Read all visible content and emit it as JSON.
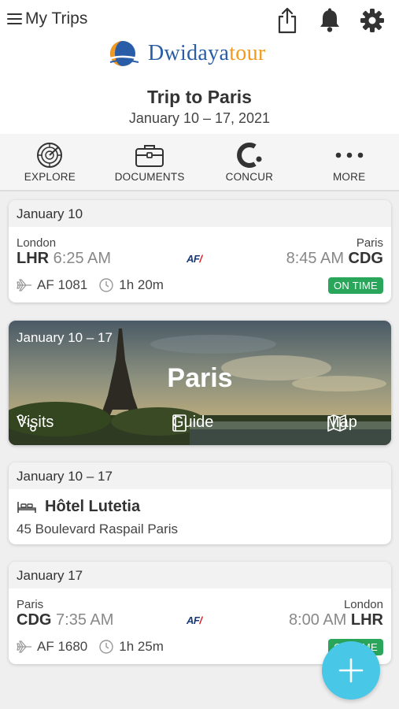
{
  "header": {
    "menu_label": "My Trips",
    "logo_text_main": "Dwidaya",
    "logo_text_accent": "tour",
    "trip_title": "Trip to Paris",
    "trip_dates": "January 10 – 17, 2021",
    "icons": [
      "share-icon",
      "bell-icon",
      "gear-icon"
    ]
  },
  "nav": [
    {
      "label": "EXPLORE",
      "icon": "radar-icon"
    },
    {
      "label": "DOCUMENTS",
      "icon": "briefcase-icon"
    },
    {
      "label": "CONCUR",
      "icon": "concur-icon"
    },
    {
      "label": "MORE",
      "icon": "more-dots-icon"
    }
  ],
  "flight1": {
    "date": "January 10",
    "from_city": "London",
    "from_code": "LHR",
    "dep_time": "6:25 AM",
    "to_city": "Paris",
    "to_code": "CDG",
    "arr_time": "8:45 AM",
    "airline_logo": "AF",
    "flight_no": "AF 1081",
    "duration": "1h 20m",
    "status": "ON TIME"
  },
  "destination": {
    "dates": "January 10 – 17",
    "name": "Paris",
    "actions": [
      "Visits",
      "Guide",
      "Map"
    ]
  },
  "hotel": {
    "date": "January 10 – 17",
    "name": "Hôtel Lutetia",
    "address": "45 Boulevard Raspail Paris"
  },
  "flight2": {
    "date": "January 17",
    "from_city": "Paris",
    "from_code": "CDG",
    "dep_time": "7:35 AM",
    "to_city": "London",
    "to_code": "LHR",
    "arr_time": "8:00 AM",
    "airline_logo": "AF",
    "flight_no": "AF 1680",
    "duration": "1h 25m",
    "status": "ON TIME"
  },
  "colors": {
    "accent": "#48c7e6",
    "status_green": "#2aa65a",
    "logo_blue": "#2a5da8",
    "logo_orange": "#f39a1e"
  }
}
